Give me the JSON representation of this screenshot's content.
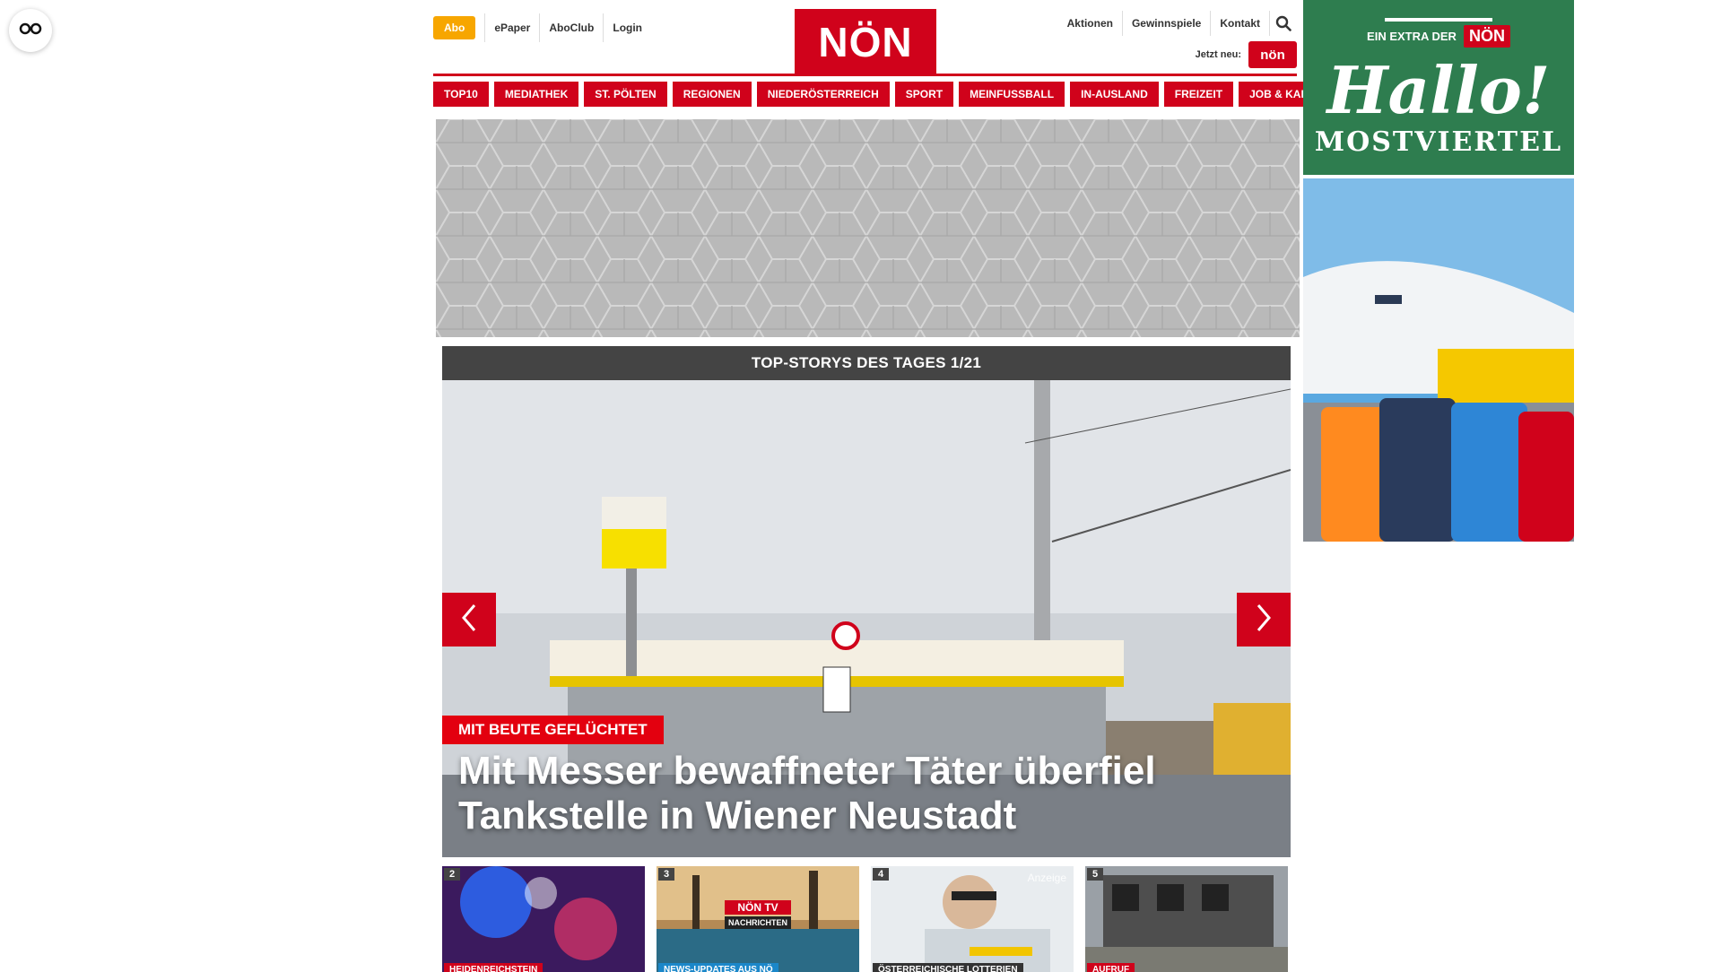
{
  "header": {
    "abo_label": "Abo",
    "top_links": [
      "ePaper",
      "AboClub",
      "Login"
    ],
    "logo_text": "NÖN",
    "right_links": [
      "Aktionen",
      "Gewinnspiele",
      "Kontakt"
    ],
    "jetzt_label": "Jetzt neu:",
    "jetzt_logo_text": "nön"
  },
  "nav": {
    "items": [
      "TOP10",
      "MEDIATHEK",
      "ST. PÖLTEN",
      "REGIONEN",
      "NIEDERÖSTERREICH",
      "SPORT",
      "MEINFUSSBALL",
      "IN-AUSLAND",
      "FREIZEIT",
      "JOB & KARRIERE"
    ]
  },
  "side_ad": {
    "extra_text": "EIN EXTRA DER",
    "extra_logo": "NÖN",
    "hallo": "Hallo!",
    "region": "MOSTVIERTEL"
  },
  "topstories": {
    "header": "TOP-STORYS DES TAGES 1/21",
    "kicker": "MIT BEUTE GEFLÜCHTET",
    "headline": "Mit Messer bewaffneter Täter überfiel Tankstelle in Wiener Neustadt"
  },
  "thumbs": [
    {
      "num": "2",
      "category": "HEIDENREICHSTEIN"
    },
    {
      "num": "3",
      "category": "NEWS-UPDATES AUS NÖ",
      "tv_title": "NÖN TV",
      "tv_sub": "NACHRICHTEN"
    },
    {
      "num": "4",
      "category": "ÖSTERREICHISCHE LOTTERIEN",
      "anzeige": "Anzeige"
    },
    {
      "num": "5",
      "category": "AUFRUF"
    }
  ],
  "colors": {
    "brand_red": "#d0021b",
    "abo_orange": "#f7a600",
    "ad_green": "#2e7d4f"
  }
}
